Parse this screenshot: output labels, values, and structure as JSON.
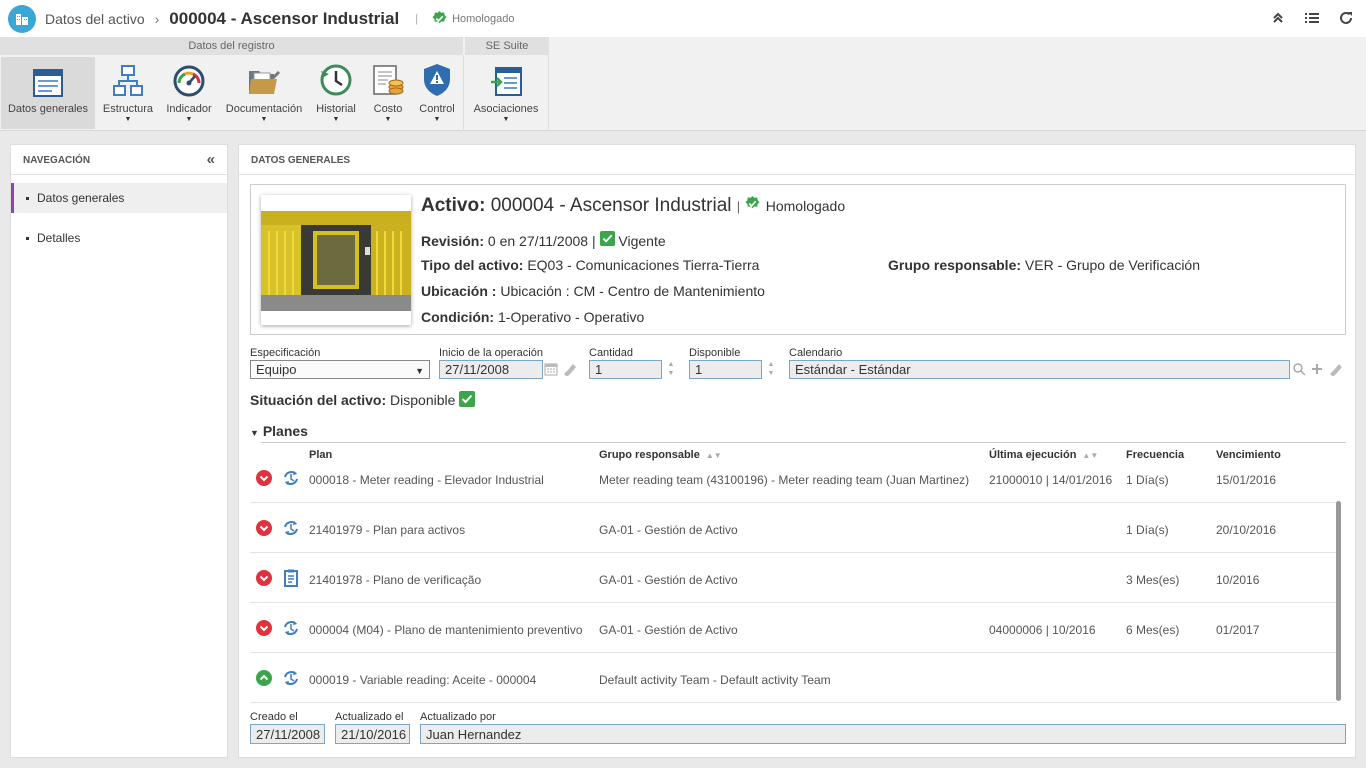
{
  "header": {
    "breadcrumb": "Datos del activo",
    "title": "000004 - Ascensor Industrial",
    "status": "Homologado"
  },
  "ribbon": {
    "groups": [
      "Datos del registro",
      "SE Suite"
    ],
    "buttons": [
      "Datos generales",
      "Estructura",
      "Indicador",
      "Documentación",
      "Historial",
      "Costo",
      "Control",
      "Asociaciones"
    ]
  },
  "nav": {
    "title": "NAVEGACIÓN",
    "items": [
      "Datos generales",
      "Detalles"
    ]
  },
  "main": {
    "title": "DATOS GENERALES",
    "card": {
      "activo_label": "Activo:",
      "activo_value": "000004 - Ascensor Industrial",
      "activo_status": "Homologado",
      "revision_label": "Revisión:",
      "revision_value": "0 en 27/11/2008 |",
      "revision_status": "Vigente",
      "tipo_label": "Tipo del activo:",
      "tipo_value": "EQ03 - Comunicaciones Tierra-Tierra",
      "grupo_label": "Grupo responsable:",
      "grupo_value": "VER - Grupo de Verificación",
      "ubicacion_label": "Ubicación :",
      "ubicacion_value": "Ubicación : CM - Centro de Mantenimiento",
      "condicion_label": "Condición:",
      "condicion_value": "1-Operativo - Operativo"
    },
    "fields": {
      "especificacion_label": "Especificación",
      "especificacion_value": "Equipo",
      "inicio_label": "Inicio de la operación",
      "inicio_value": "27/11/2008",
      "cantidad_label": "Cantidad",
      "cantidad_value": "1",
      "disponible_label": "Disponible",
      "disponible_value": "1",
      "calendario_label": "Calendario",
      "calendario_value": "Estándar - Estándar"
    },
    "situacion_label": "Situación del activo:",
    "situacion_value": "Disponible",
    "planes": {
      "title": "Planes",
      "columns": [
        "Plan",
        "Grupo responsable",
        "Última ejecución",
        "Frecuencia",
        "Vencimiento"
      ],
      "rows": [
        {
          "state": "down",
          "icon": "cycle-icon",
          "plan": "000018 - Meter reading - Elevador Industrial",
          "grupo": "Meter reading team (43100196) - Meter reading team (Juan Martinez)",
          "ultima": "21000010 | 14/01/2016",
          "frecuencia": "1 Día(s)",
          "vencimiento": "15/01/2016"
        },
        {
          "state": "down",
          "icon": "cycle-icon",
          "plan": "21401979 - Plan para activos",
          "grupo": "GA-01 - Gestión de Activo",
          "ultima": "",
          "frecuencia": "1 Día(s)",
          "vencimiento": "20/10/2016"
        },
        {
          "state": "down",
          "icon": "clipboard-icon",
          "plan": "21401978 - Plano de verificação",
          "grupo": "GA-01 - Gestión de Activo",
          "ultima": "",
          "frecuencia": "3 Mes(es)",
          "vencimiento": "10/2016"
        },
        {
          "state": "down",
          "icon": "cycle-icon",
          "plan": "000004 (M04) - Plano de mantenimiento preventivo",
          "grupo": "GA-01 - Gestión de Activo",
          "ultima": "04000006 | 10/2016",
          "frecuencia": "6 Mes(es)",
          "vencimiento": "01/2017"
        },
        {
          "state": "up",
          "icon": "cycle-icon",
          "plan": "000019 - Variable reading: Aceite - 000004",
          "grupo": "Default activity Team - Default activity Team",
          "ultima": "",
          "frecuencia": "",
          "vencimiento": ""
        }
      ]
    },
    "footer": {
      "creado_label": "Creado el",
      "creado_value": "27/11/2008",
      "actualizado_label": "Actualizado el",
      "actualizado_value": "21/10/2016",
      "actualizado_por_label": "Actualizado por",
      "actualizado_por_value": "Juan Hernandez"
    }
  },
  "colors": {
    "accent": "#8e44ad",
    "red": "#e0313e",
    "green": "#3aa54a",
    "blue": "#3f7fc1"
  }
}
